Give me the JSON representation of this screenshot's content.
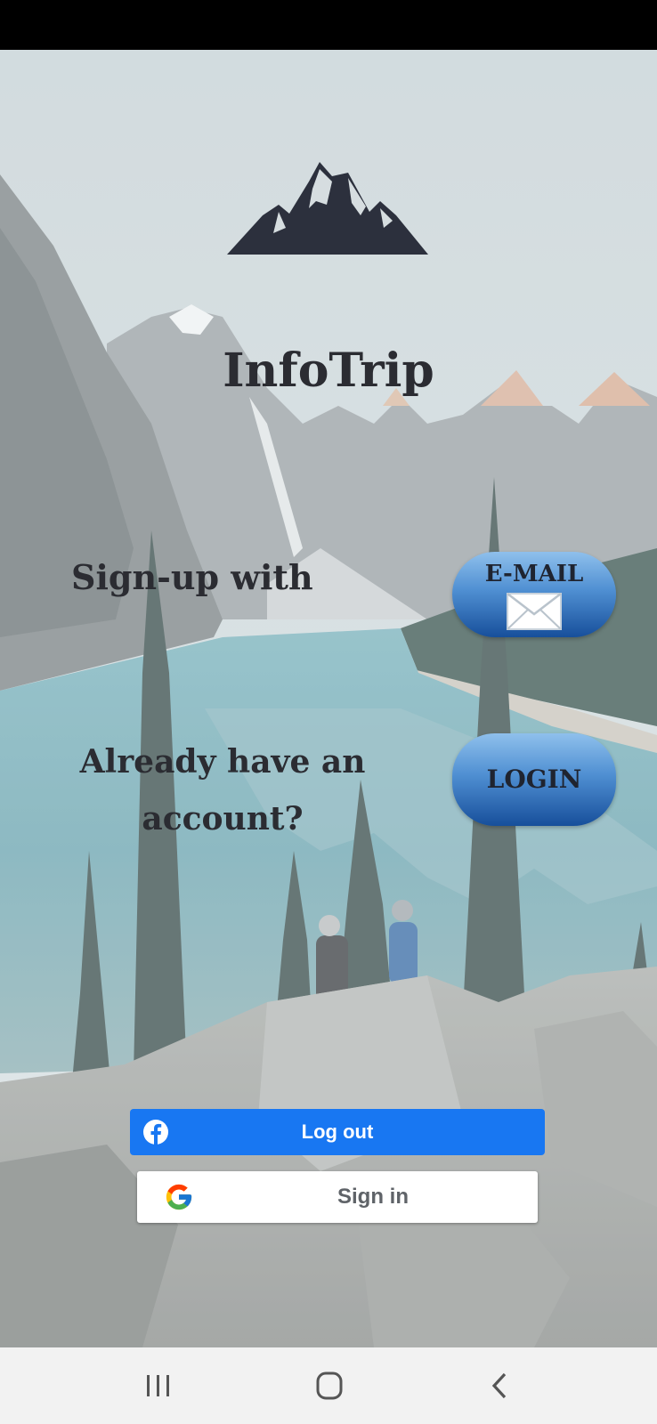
{
  "app": {
    "title": "InfoTrip"
  },
  "signup": {
    "label": "Sign-up with",
    "email_button_label": "E-MAIL"
  },
  "login": {
    "label": "Already have an account?",
    "button_label": "LOGIN"
  },
  "facebook": {
    "button_label": "Log out",
    "icon": "facebook-icon"
  },
  "google": {
    "button_label": "Sign in",
    "icon": "google-icon"
  },
  "navigation": {
    "buttons": [
      "recent-apps-icon",
      "home-icon",
      "back-icon"
    ]
  },
  "colors": {
    "facebook_blue": "#1877f2",
    "title_text": "#2b2c32",
    "button_gradient_top": "#8fc0ec",
    "button_gradient_bottom": "#174f9b"
  }
}
